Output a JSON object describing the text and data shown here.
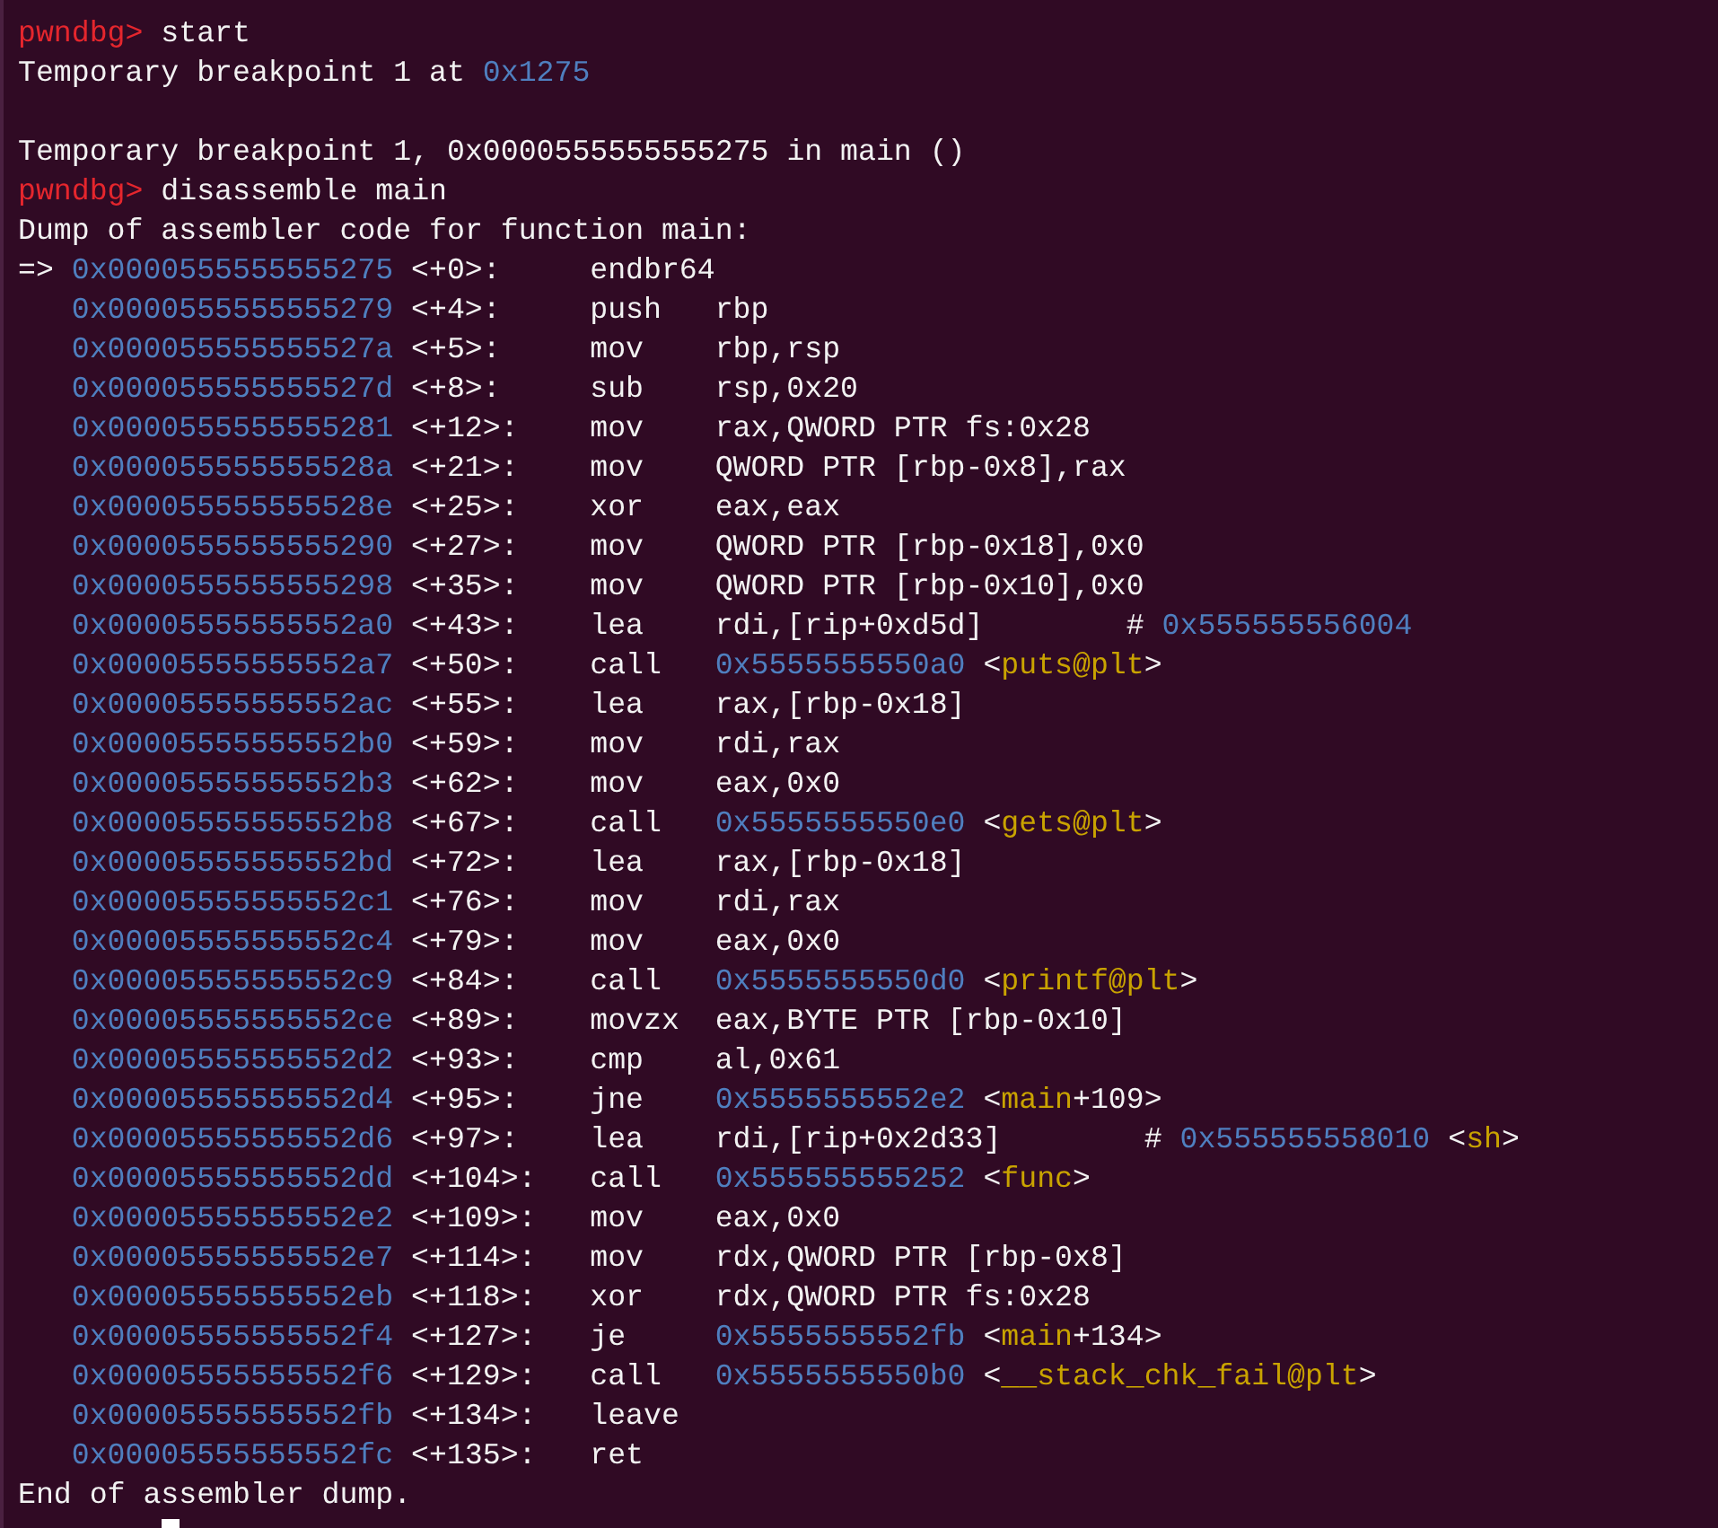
{
  "terminal": {
    "lines": [
      {
        "kind": "prompt",
        "prompt": "pwndbg>",
        "command": "start"
      },
      {
        "kind": "text",
        "segments": [
          {
            "text": "Temporary breakpoint 1 at ",
            "kind": "text"
          },
          {
            "text": "0x1275",
            "kind": "address"
          }
        ]
      },
      {
        "kind": "blank"
      },
      {
        "kind": "text",
        "segments": [
          {
            "text": "Temporary breakpoint 1, 0x0000555555555275 in main ()",
            "kind": "text"
          }
        ]
      },
      {
        "kind": "prompt",
        "prompt": "pwndbg>",
        "command": "disassemble main"
      },
      {
        "kind": "text",
        "segments": [
          {
            "text": "Dump of assembler code for function main:",
            "kind": "text"
          }
        ]
      },
      {
        "kind": "asm",
        "arrow": "=>",
        "address": "0x0000555555555275",
        "offset": "<+0>:",
        "mnemonic": "endbr64"
      },
      {
        "kind": "asm",
        "address": "0x0000555555555279",
        "offset": "<+4>:",
        "mnemonic": "push",
        "operands": [
          {
            "text": "rbp",
            "kind": "text"
          }
        ]
      },
      {
        "kind": "asm",
        "address": "0x000055555555527a",
        "offset": "<+5>:",
        "mnemonic": "mov",
        "operands": [
          {
            "text": "rbp,rsp",
            "kind": "text"
          }
        ]
      },
      {
        "kind": "asm",
        "address": "0x000055555555527d",
        "offset": "<+8>:",
        "mnemonic": "sub",
        "operands": [
          {
            "text": "rsp,0x20",
            "kind": "text"
          }
        ]
      },
      {
        "kind": "asm",
        "address": "0x0000555555555281",
        "offset": "<+12>:",
        "mnemonic": "mov",
        "operands": [
          {
            "text": "rax,QWORD PTR fs:0x28",
            "kind": "text"
          }
        ]
      },
      {
        "kind": "asm",
        "address": "0x000055555555528a",
        "offset": "<+21>:",
        "mnemonic": "mov",
        "operands": [
          {
            "text": "QWORD PTR [rbp-0x8],rax",
            "kind": "text"
          }
        ]
      },
      {
        "kind": "asm",
        "address": "0x000055555555528e",
        "offset": "<+25>:",
        "mnemonic": "xor",
        "operands": [
          {
            "text": "eax,eax",
            "kind": "text"
          }
        ]
      },
      {
        "kind": "asm",
        "address": "0x0000555555555290",
        "offset": "<+27>:",
        "mnemonic": "mov",
        "operands": [
          {
            "text": "QWORD PTR [rbp-0x18],0x0",
            "kind": "text"
          }
        ]
      },
      {
        "kind": "asm",
        "address": "0x0000555555555298",
        "offset": "<+35>:",
        "mnemonic": "mov",
        "operands": [
          {
            "text": "QWORD PTR [rbp-0x10],0x0",
            "kind": "text"
          }
        ]
      },
      {
        "kind": "asm",
        "address": "0x00005555555552a0",
        "offset": "<+43>:",
        "mnemonic": "lea",
        "operands": [
          {
            "text": "rdi,[rip+0xd5d]",
            "kind": "text"
          }
        ],
        "comment": [
          {
            "text": "#",
            "kind": "text"
          },
          {
            "text": "0x555555556004",
            "kind": "address"
          }
        ]
      },
      {
        "kind": "asm",
        "address": "0x00005555555552a7",
        "offset": "<+50>:",
        "mnemonic": "call",
        "operands": [
          {
            "text": "0x5555555550a0",
            "kind": "address"
          },
          {
            "text": "<",
            "kind": "text"
          },
          {
            "text": "puts@plt",
            "kind": "symbol"
          },
          {
            "text": ">",
            "kind": "text"
          }
        ]
      },
      {
        "kind": "asm",
        "address": "0x00005555555552ac",
        "offset": "<+55>:",
        "mnemonic": "lea",
        "operands": [
          {
            "text": "rax,[rbp-0x18]",
            "kind": "text"
          }
        ]
      },
      {
        "kind": "asm",
        "address": "0x00005555555552b0",
        "offset": "<+59>:",
        "mnemonic": "mov",
        "operands": [
          {
            "text": "rdi,rax",
            "kind": "text"
          }
        ]
      },
      {
        "kind": "asm",
        "address": "0x00005555555552b3",
        "offset": "<+62>:",
        "mnemonic": "mov",
        "operands": [
          {
            "text": "eax,0x0",
            "kind": "text"
          }
        ]
      },
      {
        "kind": "asm",
        "address": "0x00005555555552b8",
        "offset": "<+67>:",
        "mnemonic": "call",
        "operands": [
          {
            "text": "0x5555555550e0",
            "kind": "address"
          },
          {
            "text": "<",
            "kind": "text"
          },
          {
            "text": "gets@plt",
            "kind": "symbol"
          },
          {
            "text": ">",
            "kind": "text"
          }
        ]
      },
      {
        "kind": "asm",
        "address": "0x00005555555552bd",
        "offset": "<+72>:",
        "mnemonic": "lea",
        "operands": [
          {
            "text": "rax,[rbp-0x18]",
            "kind": "text"
          }
        ]
      },
      {
        "kind": "asm",
        "address": "0x00005555555552c1",
        "offset": "<+76>:",
        "mnemonic": "mov",
        "operands": [
          {
            "text": "rdi,rax",
            "kind": "text"
          }
        ]
      },
      {
        "kind": "asm",
        "address": "0x00005555555552c4",
        "offset": "<+79>:",
        "mnemonic": "mov",
        "operands": [
          {
            "text": "eax,0x0",
            "kind": "text"
          }
        ]
      },
      {
        "kind": "asm",
        "address": "0x00005555555552c9",
        "offset": "<+84>:",
        "mnemonic": "call",
        "operands": [
          {
            "text": "0x5555555550d0",
            "kind": "address"
          },
          {
            "text": "<",
            "kind": "text"
          },
          {
            "text": "printf@plt",
            "kind": "symbol"
          },
          {
            "text": ">",
            "kind": "text"
          }
        ]
      },
      {
        "kind": "asm",
        "address": "0x00005555555552ce",
        "offset": "<+89>:",
        "mnemonic": "movzx",
        "operands": [
          {
            "text": "eax,BYTE PTR [rbp-0x10]",
            "kind": "text"
          }
        ]
      },
      {
        "kind": "asm",
        "address": "0x00005555555552d2",
        "offset": "<+93>:",
        "mnemonic": "cmp",
        "operands": [
          {
            "text": "al,0x61",
            "kind": "text"
          }
        ]
      },
      {
        "kind": "asm",
        "address": "0x00005555555552d4",
        "offset": "<+95>:",
        "mnemonic": "jne",
        "operands": [
          {
            "text": "0x5555555552e2",
            "kind": "address"
          },
          {
            "text": "<",
            "kind": "text"
          },
          {
            "text": "main",
            "kind": "symbol"
          },
          {
            "text": "+109>",
            "kind": "text"
          }
        ]
      },
      {
        "kind": "asm",
        "address": "0x00005555555552d6",
        "offset": "<+97>:",
        "mnemonic": "lea",
        "operands": [
          {
            "text": "rdi,[rip+0x2d33]",
            "kind": "text"
          }
        ],
        "comment": [
          {
            "text": "#",
            "kind": "text"
          },
          {
            "text": "0x555555558010",
            "kind": "address"
          },
          {
            "text": "<",
            "kind": "text"
          },
          {
            "text": "sh",
            "kind": "symbol"
          },
          {
            "text": ">",
            "kind": "text"
          }
        ]
      },
      {
        "kind": "asm",
        "address": "0x00005555555552dd",
        "offset": "<+104>:",
        "mnemonic": "call",
        "operands": [
          {
            "text": "0x555555555252",
            "kind": "address"
          },
          {
            "text": "<",
            "kind": "text"
          },
          {
            "text": "func",
            "kind": "symbol"
          },
          {
            "text": ">",
            "kind": "text"
          }
        ]
      },
      {
        "kind": "asm",
        "address": "0x00005555555552e2",
        "offset": "<+109>:",
        "mnemonic": "mov",
        "operands": [
          {
            "text": "eax,0x0",
            "kind": "text"
          }
        ]
      },
      {
        "kind": "asm",
        "address": "0x00005555555552e7",
        "offset": "<+114>:",
        "mnemonic": "mov",
        "operands": [
          {
            "text": "rdx,QWORD PTR [rbp-0x8]",
            "kind": "text"
          }
        ]
      },
      {
        "kind": "asm",
        "address": "0x00005555555552eb",
        "offset": "<+118>:",
        "mnemonic": "xor",
        "operands": [
          {
            "text": "rdx,QWORD PTR fs:0x28",
            "kind": "text"
          }
        ]
      },
      {
        "kind": "asm",
        "address": "0x00005555555552f4",
        "offset": "<+127>:",
        "mnemonic": "je",
        "operands": [
          {
            "text": "0x5555555552fb",
            "kind": "address"
          },
          {
            "text": "<",
            "kind": "text"
          },
          {
            "text": "main",
            "kind": "symbol"
          },
          {
            "text": "+134>",
            "kind": "text"
          }
        ]
      },
      {
        "kind": "asm",
        "address": "0x00005555555552f6",
        "offset": "<+129>:",
        "mnemonic": "call",
        "operands": [
          {
            "text": "0x5555555550b0",
            "kind": "address"
          },
          {
            "text": "<",
            "kind": "text"
          },
          {
            "text": "__stack_chk_fail@plt",
            "kind": "symbol"
          },
          {
            "text": ">",
            "kind": "text"
          }
        ]
      },
      {
        "kind": "asm",
        "address": "0x00005555555552fb",
        "offset": "<+134>:",
        "mnemonic": "leave"
      },
      {
        "kind": "asm",
        "address": "0x00005555555552fc",
        "offset": "<+135>:",
        "mnemonic": "ret"
      },
      {
        "kind": "text",
        "segments": [
          {
            "text": "End of assembler dump.",
            "kind": "text"
          }
        ]
      },
      {
        "kind": "cursor"
      }
    ]
  }
}
